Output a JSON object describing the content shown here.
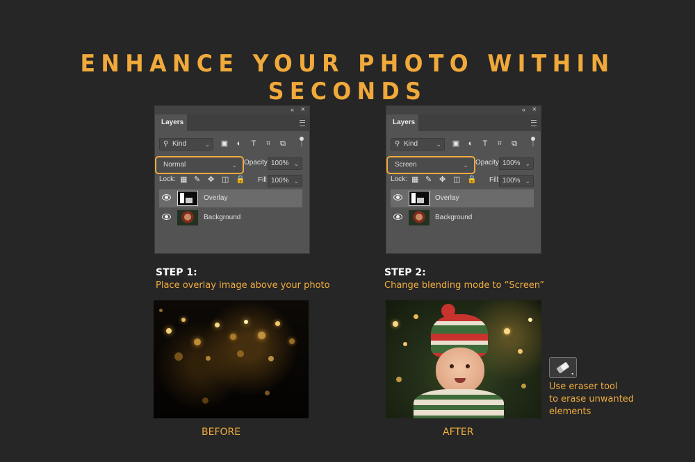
{
  "headline": "ENHANCE YOUR PHOTO WITHIN SECONDS",
  "panels": [
    {
      "tab_label": "Layers",
      "kind_label": "Kind",
      "blend_mode": "Normal",
      "opacity_label": "Opacity:",
      "opacity_value": "100%",
      "lock_label": "Lock:",
      "fill_label": "Fill:",
      "fill_value": "100%",
      "layers": [
        "Overlay",
        "Background"
      ]
    },
    {
      "tab_label": "Layers",
      "kind_label": "Kind",
      "blend_mode": "Screen",
      "opacity_label": "Opacity:",
      "opacity_value": "100%",
      "lock_label": "Lock:",
      "fill_label": "Fill:",
      "fill_value": "100%",
      "layers": [
        "Overlay",
        "Background"
      ]
    }
  ],
  "steps": [
    {
      "title": "STEP 1:",
      "desc": "Place overlay image above your photo"
    },
    {
      "title": "STEP 2:",
      "desc": "Change blending mode to “Screen”"
    }
  ],
  "captions": {
    "before": "BEFORE",
    "after": "AFTER"
  },
  "eraser_note": [
    "Use eraser tool",
    "to erase unwanted",
    "elements"
  ],
  "colors": {
    "accent": "#f0ad3f",
    "panel": "#535353",
    "background": "#262626"
  },
  "icons": [
    "search-icon",
    "image-filter-icon",
    "adjustment-filter-icon",
    "type-filter-icon",
    "shape-filter-icon",
    "smart-object-filter-icon",
    "eye-icon",
    "eraser-icon"
  ]
}
